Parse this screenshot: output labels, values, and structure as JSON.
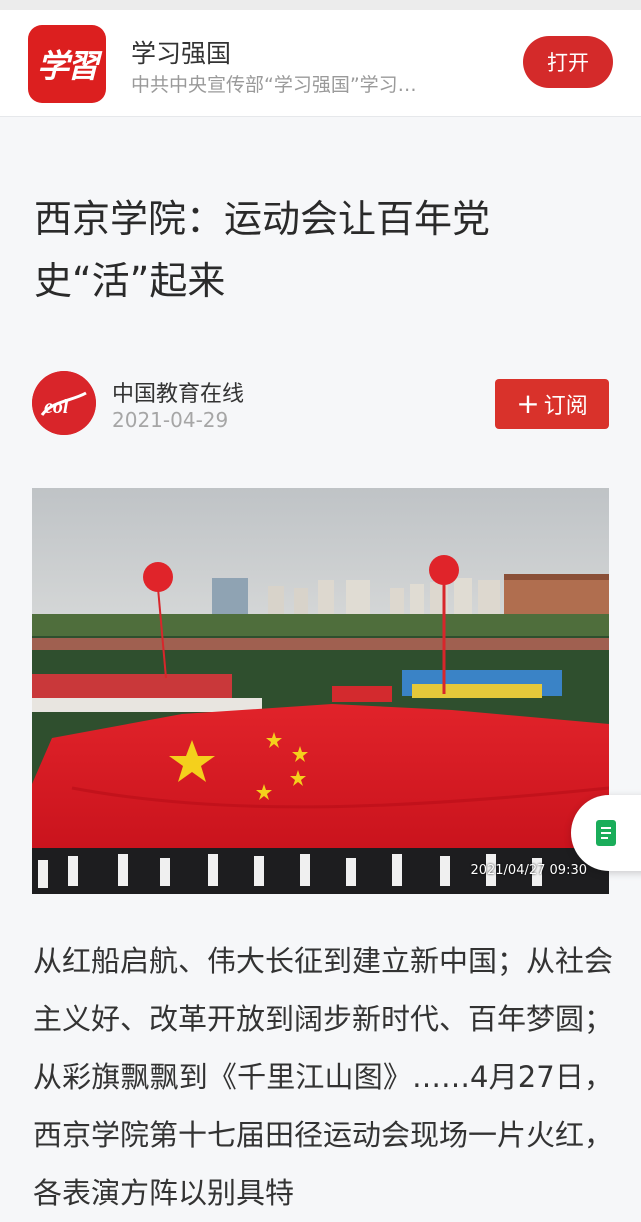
{
  "app": {
    "logo_text": "学習",
    "name": "学习强国",
    "description": "中共中央宣传部“学习强国”学习…",
    "open_label": "打开"
  },
  "article": {
    "title": "西京学院：运动会让百年党史“活”起来",
    "author": "中国教育在线",
    "date": "2021-04-29",
    "subscribe_label": "订阅",
    "photo_timestamp": "2021/04/27 09:30",
    "body": "从红船启航、伟大长征到建立新中国；从社会主义好、改革开放到阔步新时代、百年梦圆；从彩旗飘飘到《千里江山图》……4月27日，西京学院第十七届田径运动会现场一片火红，各表演方阵以别具特"
  },
  "icons": {
    "avatar": "eol-logo-icon",
    "plus": "plus-icon",
    "float": "document-icon"
  },
  "colors": {
    "brand_red": "#dc1f1f",
    "button_red": "#d42a2a",
    "float_icon_green": "#1aad5a"
  }
}
